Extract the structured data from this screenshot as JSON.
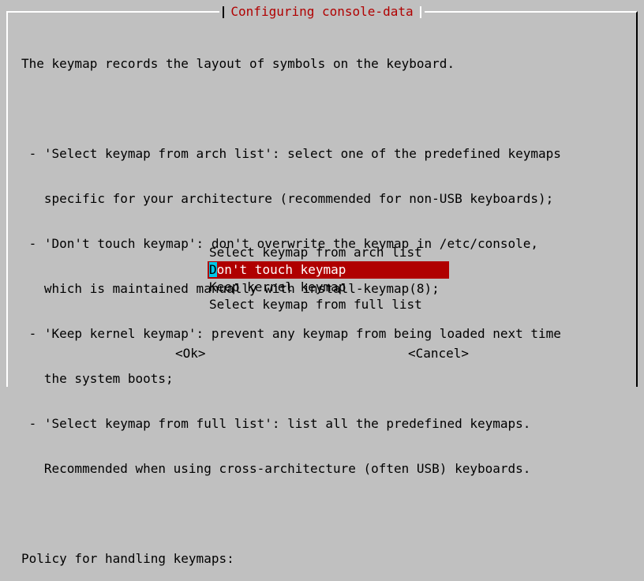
{
  "dialog": {
    "title": "Configuring console-data",
    "title_color": "#b00000",
    "background": "#c0c0c0"
  },
  "description": {
    "lines": [
      "The keymap records the layout of symbols on the keyboard.",
      "",
      " - 'Select keymap from arch list': select one of the predefined keymaps",
      "   specific for your architecture (recommended for non-USB keyboards);",
      " - 'Don't touch keymap': don't overwrite the keymap in /etc/console,",
      "   which is maintained manually with install-keymap(8);",
      " - 'Keep kernel keymap': prevent any keymap from being loaded next time",
      "   the system boots;",
      " - 'Select keymap from full list': list all the predefined keymaps.",
      "   Recommended when using cross-architecture (often USB) keyboards.",
      "",
      "Policy for handling keymaps:"
    ]
  },
  "menu": {
    "selected_index": 1,
    "selected_bg": "#b00000",
    "cursor_color": "#00c8e8",
    "items": [
      {
        "label": "Select keymap from arch list"
      },
      {
        "label": "Don't touch keymap",
        "first_char": "D",
        "rest": "on't touch keymap"
      },
      {
        "label": "Keep kernel keymap"
      },
      {
        "label": "Select keymap from full list"
      }
    ]
  },
  "buttons": {
    "ok_label": "<Ok>",
    "cancel_label": "<Cancel>"
  }
}
